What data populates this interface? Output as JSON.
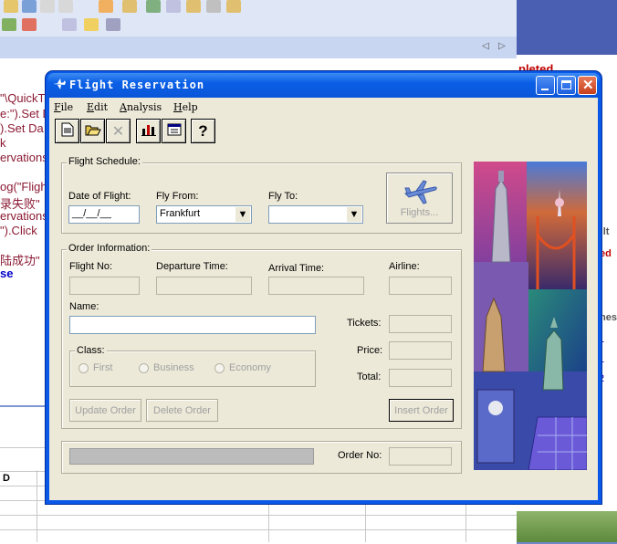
{
  "window": {
    "title": "Flight Reservation"
  },
  "menu": [
    {
      "label": "File",
      "u": "F"
    },
    {
      "label": "Edit",
      "u": "E"
    },
    {
      "label": "Analysis",
      "u": "A"
    },
    {
      "label": "Help",
      "u": "H"
    }
  ],
  "background_code": [
    "\"\\QuickT",
    "e:\").Set D",
    ").Set Da",
    "k",
    "ervations",
    "og(\"Fligh",
    "录失败\"",
    "ervations",
    "\").Click",
    "陆成功\"",
    "se"
  ],
  "background_right": {
    "top_text": "pleted",
    "col1": "ult",
    "col2": "led",
    "col3": "mes",
    "row1": "1",
    "row2": "1",
    "row3": "2"
  },
  "grid_header": "D",
  "flight_schedule": {
    "title": "Flight Schedule:",
    "date_label": "Date of Flight:",
    "date_value": "__/__/__",
    "from_label": "Fly From:",
    "from_value": "Frankfurt",
    "to_label": "Fly To:",
    "to_value": "",
    "flights_button": "Flights..."
  },
  "order_info": {
    "title": "Order Information:",
    "flight_no_label": "Flight No:",
    "departure_label": "Departure Time:",
    "arrival_label": "Arrival Time:",
    "airline_label": "Airline:",
    "name_label": "Name:",
    "tickets_label": "Tickets:",
    "price_label": "Price:",
    "total_label": "Total:",
    "class_label": "Class:",
    "class_options": [
      "First",
      "Business",
      "Economy"
    ],
    "update_button": "Update Order",
    "delete_button": "Delete Order",
    "insert_button": "Insert Order"
  },
  "order_no_label": "Order No:",
  "colors": {
    "titlebar": "#0a5fe6",
    "face": "#ece9d8",
    "code": "#8b1a33",
    "keyword": "#0000c8"
  }
}
